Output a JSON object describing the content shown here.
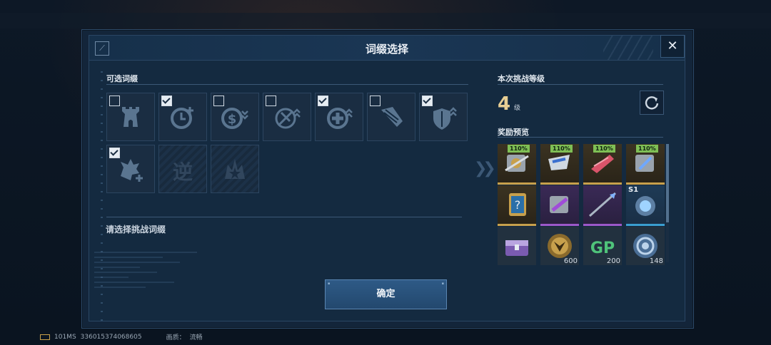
{
  "dialog": {
    "title": "词缀选择",
    "close_icon": "close-icon"
  },
  "affixes": {
    "section_label": "可选词缀",
    "items": [
      {
        "icon": "tower-icon",
        "checked": false,
        "locked": false
      },
      {
        "icon": "clock-plus-icon",
        "checked": true,
        "locked": false
      },
      {
        "icon": "coin-down-icon",
        "checked": false,
        "locked": false
      },
      {
        "icon": "no-attack-up-icon",
        "checked": false,
        "locked": false
      },
      {
        "icon": "heal-up-icon",
        "checked": true,
        "locked": false
      },
      {
        "icon": "drill-icon",
        "checked": false,
        "locked": false
      },
      {
        "icon": "shield-up-icon",
        "checked": true,
        "locked": false
      },
      {
        "icon": "beast-plus-icon",
        "checked": true,
        "locked": false
      },
      {
        "icon": "reverse-icon",
        "checked": false,
        "locked": true,
        "glyph": "逆"
      },
      {
        "icon": "crown-star-icon",
        "checked": false,
        "locked": true
      }
    ],
    "hint": "请选择挑战词缀"
  },
  "challenge": {
    "section_label": "本次挑战等级",
    "level": "4",
    "level_unit": "级"
  },
  "rewards": {
    "section_label": "奖励预览",
    "items": [
      {
        "rarity": "gold",
        "badge": "110%",
        "icon": "gear-kit-icon"
      },
      {
        "rarity": "gold",
        "badge": "110%",
        "icon": "mask-blade-icon"
      },
      {
        "rarity": "gold",
        "badge": "110%",
        "icon": "jet-part-icon"
      },
      {
        "rarity": "gold",
        "badge": "110%",
        "icon": "crystal-kit-icon"
      },
      {
        "rarity": "gold",
        "icon": "mystery-card-icon"
      },
      {
        "rarity": "purple",
        "icon": "purple-gem-kit-icon"
      },
      {
        "rarity": "purple",
        "icon": "spear-icon"
      },
      {
        "rarity": "blue",
        "icon": "blue-core-icon",
        "label": "S1"
      },
      {
        "rarity": "none",
        "icon": "chest-icon"
      },
      {
        "rarity": "none",
        "icon": "gold-coin-icon",
        "count": "600"
      },
      {
        "rarity": "none",
        "icon": "gp-icon",
        "count": "200"
      },
      {
        "rarity": "none",
        "icon": "silver-coin-icon",
        "count": "148"
      }
    ]
  },
  "confirm_label": "确定",
  "status_bar": {
    "ping": "101MS",
    "uid": "336015374068605",
    "quality_label": "画质：",
    "quality_value": "流畅"
  },
  "colors": {
    "accent_gold": "#e8cf94",
    "badge_green": "#7fbf55",
    "confirm_blue": "#2e5a86"
  }
}
